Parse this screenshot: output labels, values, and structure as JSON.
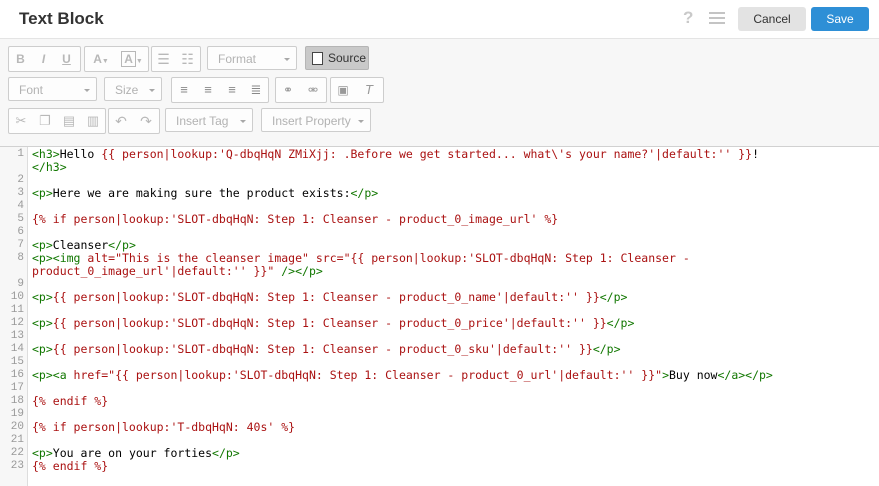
{
  "header": {
    "title": "Text Block",
    "help": "?",
    "cancel_label": "Cancel",
    "save_label": "Save"
  },
  "toolbar": {
    "row1": {
      "bold": "B",
      "italic": "I",
      "underline": "U",
      "text_color": "A",
      "bg_color": "A",
      "format_placeholder": "Format",
      "source_label": "Source"
    },
    "row2": {
      "font_placeholder": "Font",
      "size_placeholder": "Size"
    },
    "row3": {
      "insert_tag_label": "Insert Tag",
      "insert_property_label": "Insert Property"
    },
    "icons": [
      "bold-icon",
      "italic-icon",
      "underline-icon",
      "text-color-icon",
      "background-color-icon",
      "bulleted-list-icon",
      "numbered-list-icon",
      "source-icon",
      "align-left-icon",
      "align-center-icon",
      "align-right-icon",
      "justify-icon",
      "link-icon",
      "unlink-icon",
      "image-icon",
      "remove-format-icon",
      "cut-icon",
      "copy-icon",
      "paste-icon",
      "paste-text-icon",
      "undo-icon",
      "redo-icon"
    ]
  },
  "editor": {
    "line_numbers": [
      "1",
      "",
      "2",
      "3",
      "4",
      "5",
      "6",
      "7",
      "8",
      "",
      "9",
      "10",
      "11",
      "12",
      "13",
      "14",
      "15",
      "16",
      "17",
      "18",
      "19",
      "20",
      "21",
      "22",
      "23"
    ],
    "lines": [
      [
        [
          "t",
          "<h3>"
        ],
        [
          "",
          "Hello "
        ],
        [
          "s",
          "{{ person|lookup:'Q-dbqHqN ZMiXjj: .Before we get started... what\\'s your name?'|default:'' }}"
        ],
        [
          "",
          "!"
        ]
      ],
      [
        [
          "t",
          "</h3>"
        ]
      ],
      [],
      [
        [
          "t",
          "<p>"
        ],
        [
          "",
          "Here we are making sure the product exists:"
        ],
        [
          "t",
          "</p>"
        ]
      ],
      [],
      [
        [
          "s",
          "{% if person|lookup:'SLOT-dbqHqN: Step 1: Cleanser - product_0_image_url' %}"
        ]
      ],
      [],
      [
        [
          "t",
          "<p>"
        ],
        [
          "",
          "Cleanser"
        ],
        [
          "t",
          "</p>"
        ]
      ],
      [
        [
          "t",
          "<p><img "
        ],
        [
          "s",
          "alt=\"This is the cleanser image\" src=\"{{ person|lookup:'SLOT-dbqHqN: Step 1: Cleanser -"
        ]
      ],
      [
        [
          "s",
          "product_0_image_url'|default:'' }}\""
        ],
        [
          "t",
          " /></p>"
        ]
      ],
      [],
      [
        [
          "t",
          "<p>"
        ],
        [
          "s",
          "{{ person|lookup:'SLOT-dbqHqN: Step 1: Cleanser - product_0_name'|default:'' }}"
        ],
        [
          "t",
          "</p>"
        ]
      ],
      [],
      [
        [
          "t",
          "<p>"
        ],
        [
          "s",
          "{{ person|lookup:'SLOT-dbqHqN: Step 1: Cleanser - product_0_price'|default:'' }}"
        ],
        [
          "t",
          "</p>"
        ]
      ],
      [],
      [
        [
          "t",
          "<p>"
        ],
        [
          "s",
          "{{ person|lookup:'SLOT-dbqHqN: Step 1: Cleanser - product_0_sku'|default:'' }}"
        ],
        [
          "t",
          "</p>"
        ]
      ],
      [],
      [
        [
          "t",
          "<p><a "
        ],
        [
          "s",
          "href=\"{{ person|lookup:'SLOT-dbqHqN: Step 1: Cleanser - product_0_url'|default:'' }}\""
        ],
        [
          "t",
          ">"
        ],
        [
          "",
          "Buy now"
        ],
        [
          "t",
          "</a></p>"
        ]
      ],
      [],
      [
        [
          "s",
          "{% endif %}"
        ]
      ],
      [],
      [
        [
          "s",
          "{% if person|lookup:'T-dbqHqN: 40s' %}"
        ]
      ],
      [],
      [
        [
          "t",
          "<p>"
        ],
        [
          "",
          "You are on your forties"
        ],
        [
          "t",
          "</p>"
        ]
      ],
      [
        [
          "s",
          "{% endif %}"
        ]
      ]
    ]
  }
}
